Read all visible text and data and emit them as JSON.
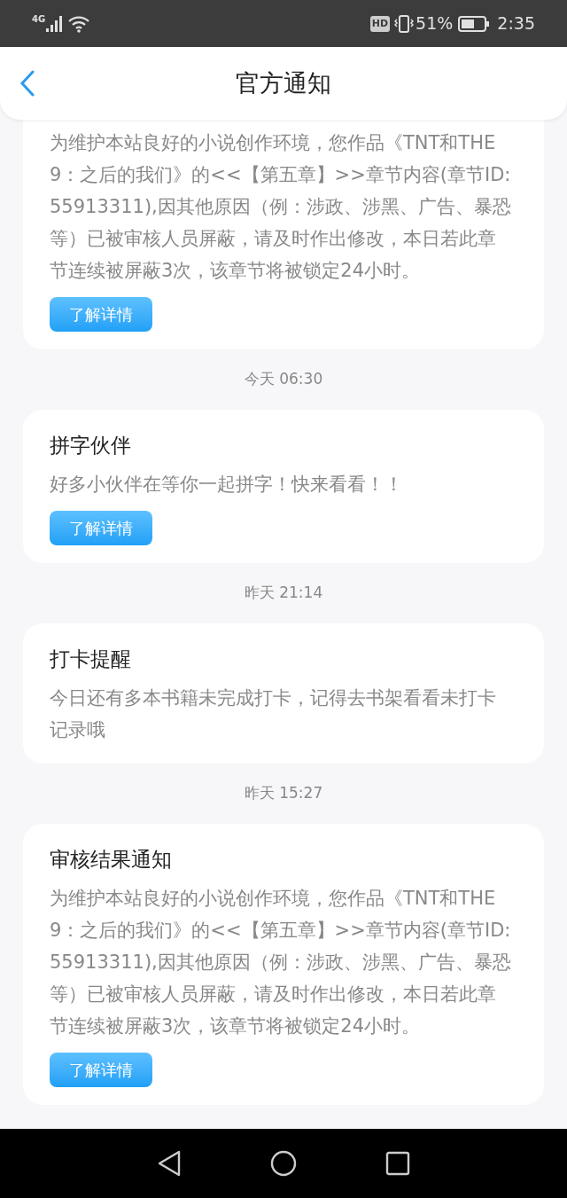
{
  "status_bar": {
    "network": "4G",
    "hd": "HD",
    "battery": "51%",
    "time": "2:35"
  },
  "header": {
    "title": "官方通知"
  },
  "feed": [
    {
      "kind": "card",
      "body": "为维护本站良好的小说创作环境，您作品《TNT和THE9：之后的我们》的<<【第五章】>>章节内容(章节ID:55913311),因其他原因（例：涉政、涉黑、广告、暴恐等）已被审核人员屏蔽，请及时作出修改，本日若此章节连续被屏蔽3次，该章节将被锁定24小时。",
      "button": "了解详情"
    },
    {
      "kind": "timestamp",
      "text": "今天 06:30"
    },
    {
      "kind": "card",
      "title": "拼字伙伴",
      "body": "好多小伙伴在等你一起拼字！快来看看！！",
      "button": "了解详情"
    },
    {
      "kind": "timestamp",
      "text": "昨天 21:14"
    },
    {
      "kind": "card",
      "title": "打卡提醒",
      "body": "今日还有多本书籍未完成打卡，记得去书架看看未打卡记录哦"
    },
    {
      "kind": "timestamp",
      "text": "昨天 15:27"
    },
    {
      "kind": "card",
      "title": "审核结果通知",
      "body": "为维护本站良好的小说创作环境，您作品《TNT和THE9：之后的我们》的<<【第五章】>>章节内容(章节ID:55913311),因其他原因（例：涉政、涉黑、广告、暴恐等）已被审核人员屏蔽，请及时作出修改，本日若此章节连续被屏蔽3次，该章节将被锁定24小时。",
      "button": "了解详情"
    }
  ]
}
